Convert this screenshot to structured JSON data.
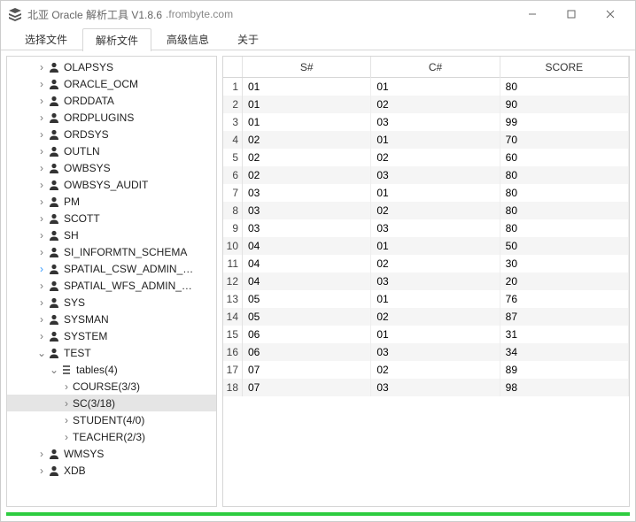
{
  "titlebar": {
    "icon": "layers-icon",
    "title": "北亚 Oracle 解析工具  V1.8.6",
    "subtitle": ".frombyte.com"
  },
  "tabs": [
    {
      "label": "选择文件",
      "active": false
    },
    {
      "label": "解析文件",
      "active": true
    },
    {
      "label": "高级信息",
      "active": false
    },
    {
      "label": "关于",
      "active": false
    }
  ],
  "tree": {
    "users": [
      {
        "label": "OLAPSYS"
      },
      {
        "label": "ORACLE_OCM"
      },
      {
        "label": "ORDDATA"
      },
      {
        "label": "ORDPLUGINS"
      },
      {
        "label": "ORDSYS"
      },
      {
        "label": "OUTLN"
      },
      {
        "label": "OWBSYS"
      },
      {
        "label": "OWBSYS_AUDIT"
      },
      {
        "label": "PM"
      },
      {
        "label": "SCOTT"
      },
      {
        "label": "SH"
      },
      {
        "label": "SI_INFORMTN_SCHEMA"
      },
      {
        "label": "SPATIAL_CSW_ADMIN_…",
        "highlight": true
      },
      {
        "label": "SPATIAL_WFS_ADMIN_…"
      },
      {
        "label": "SYS"
      },
      {
        "label": "SYSMAN"
      },
      {
        "label": "SYSTEM"
      }
    ],
    "test": {
      "label": "TEST",
      "tables_label": "tables(4)",
      "tables": [
        {
          "label": "COURSE(3/3)"
        },
        {
          "label": "SC(3/18)",
          "selected": true
        },
        {
          "label": "STUDENT(4/0)"
        },
        {
          "label": "TEACHER(2/3)"
        }
      ]
    },
    "users_after": [
      {
        "label": "WMSYS"
      },
      {
        "label": "XDB"
      }
    ]
  },
  "table": {
    "columns": [
      "S#",
      "C#",
      "SCORE"
    ],
    "rows": [
      [
        "01",
        "01",
        "80"
      ],
      [
        "01",
        "02",
        "90"
      ],
      [
        "01",
        "03",
        "99"
      ],
      [
        "02",
        "01",
        "70"
      ],
      [
        "02",
        "02",
        "60"
      ],
      [
        "02",
        "03",
        "80"
      ],
      [
        "03",
        "01",
        "80"
      ],
      [
        "03",
        "02",
        "80"
      ],
      [
        "03",
        "03",
        "80"
      ],
      [
        "04",
        "01",
        "50"
      ],
      [
        "04",
        "02",
        "30"
      ],
      [
        "04",
        "03",
        "20"
      ],
      [
        "05",
        "01",
        "76"
      ],
      [
        "05",
        "02",
        "87"
      ],
      [
        "06",
        "01",
        "31"
      ],
      [
        "06",
        "03",
        "34"
      ],
      [
        "07",
        "02",
        "89"
      ],
      [
        "07",
        "03",
        "98"
      ]
    ]
  }
}
